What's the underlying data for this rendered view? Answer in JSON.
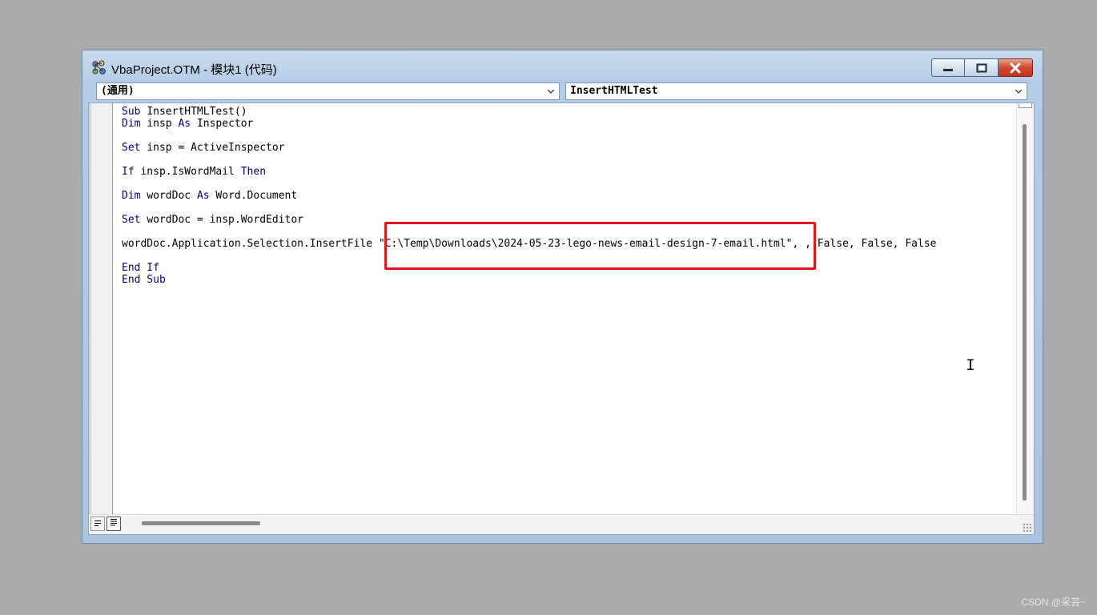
{
  "window": {
    "title": "VbaProject.OTM - 模块1 (代码)",
    "icon": "vba-project-icon",
    "buttons": {
      "minimize_icon": "minimize-icon",
      "maximize_icon": "maximize-icon",
      "close_icon": "close-icon"
    }
  },
  "object_combo": {
    "selected": "(通用)"
  },
  "procedure_combo": {
    "selected": "InsertHTMLTest"
  },
  "code": {
    "lines": [
      [
        {
          "t": "Sub ",
          "kw": true
        },
        {
          "t": "InsertHTMLTest()"
        }
      ],
      [
        {
          "t": "Dim ",
          "kw": true
        },
        {
          "t": "insp "
        },
        {
          "t": "As ",
          "kw": true
        },
        {
          "t": "Inspector"
        }
      ],
      [],
      [
        {
          "t": "Set ",
          "kw": true
        },
        {
          "t": "insp = ActiveInspector"
        }
      ],
      [],
      [
        {
          "t": "If ",
          "kw": true
        },
        {
          "t": "insp.IsWordMail "
        },
        {
          "t": "Then",
          "kw": true
        }
      ],
      [],
      [
        {
          "t": "Dim ",
          "kw": true
        },
        {
          "t": "wordDoc "
        },
        {
          "t": "As ",
          "kw": true
        },
        {
          "t": "Word.Document"
        }
      ],
      [],
      [
        {
          "t": "Set ",
          "kw": true
        },
        {
          "t": "wordDoc = insp.WordEditor"
        }
      ],
      [],
      [
        {
          "t": "wordDoc.Application.Selection.InsertFile \"C:\\Temp\\Downloads\\2024-05-23-lego-news-email-design-7-email.html\", , False, False, False"
        }
      ],
      [],
      [
        {
          "t": "End If",
          "kw": true
        }
      ],
      [
        {
          "t": "End Sub",
          "kw": true
        }
      ]
    ]
  },
  "footer": {
    "procedure_view_icon": "procedure-view-icon",
    "full_module_view_icon": "full-module-view-icon"
  },
  "watermark": "CSDN @采芸~",
  "colors": {
    "keyword": "#000080",
    "highlight_border": "#e8141b",
    "desktop": "#ababab"
  }
}
